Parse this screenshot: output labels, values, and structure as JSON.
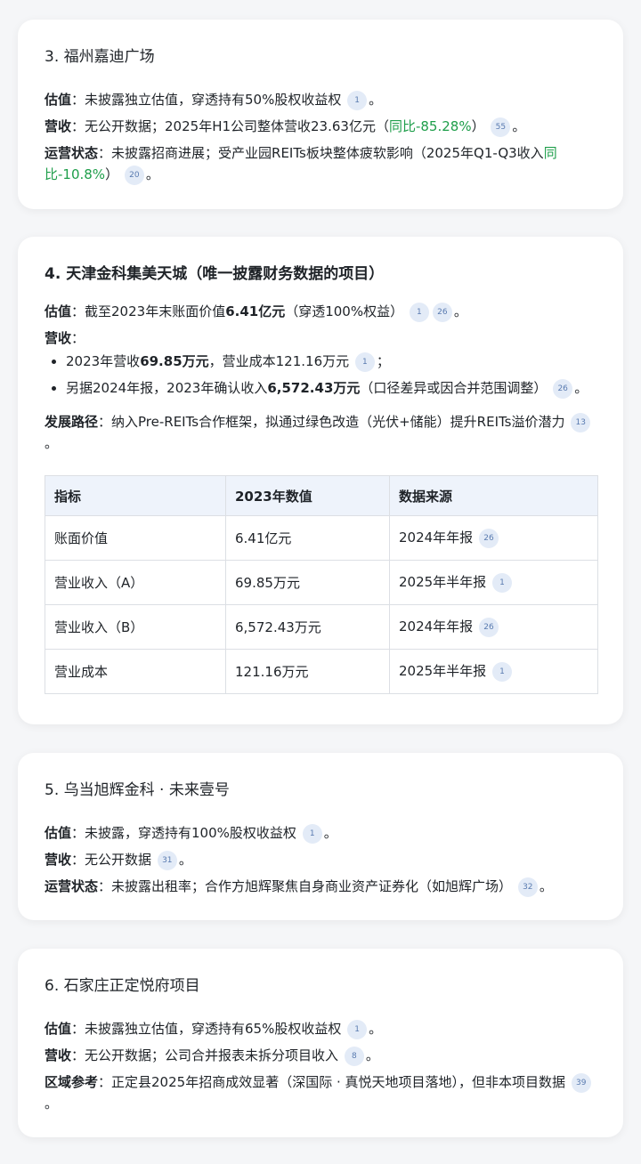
{
  "card3": {
    "title": "3. 福州嘉迪广场",
    "val_label": "估值",
    "val_text": "：未披露独立估值，穿透持有50%股权收益权",
    "val_ref": "1",
    "rev_label": "营收",
    "rev_text": "：无公开数据；2025年H1公司整体营收23.63亿元（",
    "rev_green": "同比-85.28%",
    "rev_text2": "）",
    "rev_ref": "55",
    "op_label": "运营状态",
    "op_text": "：未披露招商进展；受产业园REITs板块整体疲软影响（2025年Q1-Q3收入",
    "op_green": "同比-10.8%",
    "op_text2": "）",
    "op_ref": "20"
  },
  "card4": {
    "title": "4. 天津金科集美天城（唯一披露财务数据的项目）",
    "val_label": "估值",
    "val_text": "：截至2023年末账面价值",
    "val_bold": "6.41亿元",
    "val_text2": "（穿透100%权益）",
    "val_ref1": "1",
    "val_ref2": "26",
    "rev_label": "营收",
    "rev_colon": "：",
    "b1_text": "2023年营收",
    "b1_bold": "69.85万元",
    "b1_text2": "，营业成本121.16万元",
    "b1_ref": "1",
    "b2_text": "另据2024年报，2023年确认收入",
    "b2_bold": "6,572.43万元",
    "b2_text2": "（口径差异或因合并范围调整）",
    "b2_ref": "26",
    "path_label": "发展路径",
    "path_text": "：纳入Pre-REITs合作框架，拟通过绿色改造（光伏+储能）提升REITs溢价潜力",
    "path_ref": "13",
    "table": {
      "headers": [
        "指标",
        "2023年数值",
        "数据来源"
      ],
      "rows": [
        {
          "metric": "账面价值",
          "value": "6.41亿元",
          "source": "2024年年报",
          "ref": "26"
        },
        {
          "metric": "营业收入（A）",
          "value": "69.85万元",
          "source": "2025年半年报",
          "ref": "1"
        },
        {
          "metric": "营业收入（B）",
          "value": "6,572.43万元",
          "source": "2024年年报",
          "ref": "26"
        },
        {
          "metric": "营业成本",
          "value": "121.16万元",
          "source": "2025年半年报",
          "ref": "1"
        }
      ]
    }
  },
  "card5": {
    "title": "5. 乌当旭辉金科 · 未来壹号",
    "val_label": "估值",
    "val_text": "：未披露，穿透持有100%股权收益权",
    "val_ref": "1",
    "rev_label": "营收",
    "rev_text": "：无公开数据",
    "rev_ref": "31",
    "op_label": "运营状态",
    "op_text": "：未披露出租率；合作方旭辉聚焦自身商业资产证券化（如旭辉广场）",
    "op_ref": "32"
  },
  "card6": {
    "title": "6. 石家庄正定悦府项目",
    "val_label": "估值",
    "val_text": "：未披露独立估值，穿透持有65%股权收益权",
    "val_ref": "1",
    "rev_label": "营收",
    "rev_text": "：无公开数据；公司合并报表未拆分项目收入",
    "rev_ref": "8",
    "reg_label": "区域参考",
    "reg_text": "：正定县2025年招商成效显著（深国际 · 真悦天地项目落地），但非本项目数据",
    "reg_ref": "39"
  },
  "punct": {
    "period": "。",
    "semicolon": "；"
  },
  "colors": {
    "green": "#1e9e4a",
    "ref_bg": "#e3ebf7",
    "table_header_bg": "#eef3fb"
  }
}
